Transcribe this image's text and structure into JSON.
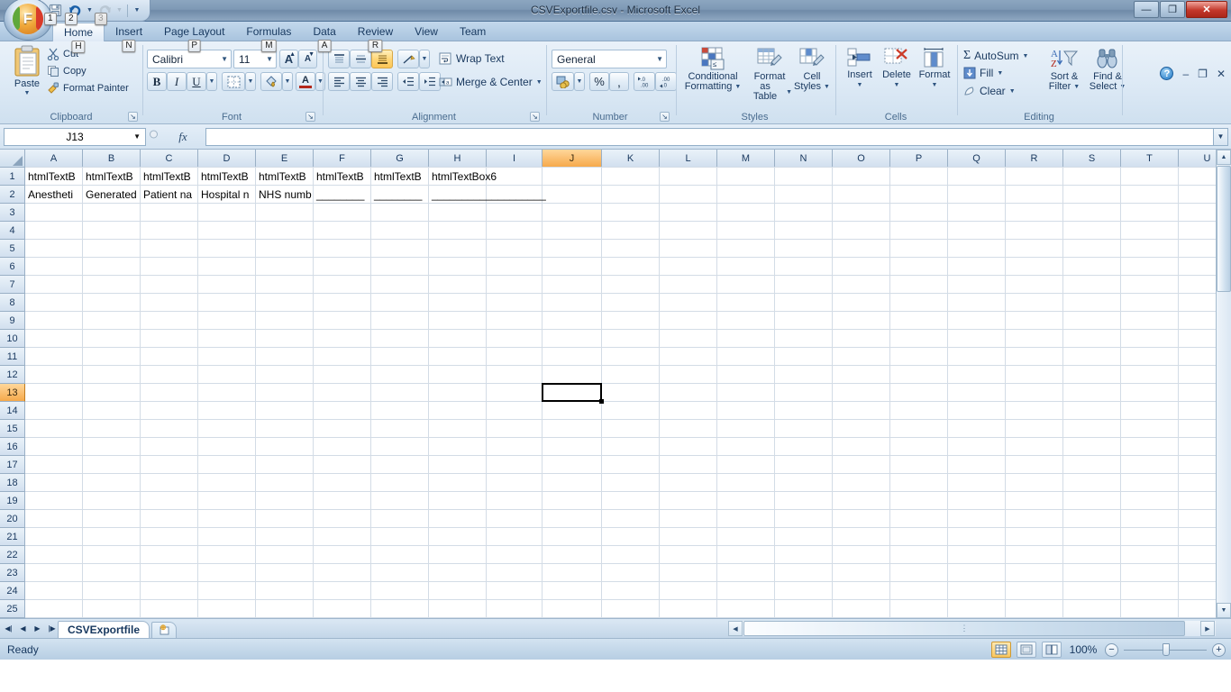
{
  "window": {
    "title": "CSVExportfile.csv - Microsoft Excel",
    "minimize_label": "—",
    "restore_label": "❐",
    "close_label": "✕"
  },
  "ribbon_window_controls": {
    "help_label": "?",
    "minimize_label": "–",
    "restore_label": "❐",
    "close_label": "✕"
  },
  "quick_access": {
    "save_icon": "save-icon",
    "undo_icon": "undo-icon",
    "redo_icon": "redo-icon",
    "customize_icon": "chevron-down-icon",
    "keytips": [
      "1",
      "2",
      "3"
    ]
  },
  "office_button": {
    "label": "F",
    "keytip": "F"
  },
  "tabs": [
    {
      "label": "Home",
      "keytip": "H",
      "active": true
    },
    {
      "label": "Insert",
      "keytip": "N",
      "active": false
    },
    {
      "label": "Page Layout",
      "keytip": "P",
      "active": false
    },
    {
      "label": "Formulas",
      "keytip": "M",
      "active": false
    },
    {
      "label": "Data",
      "keytip": "A",
      "active": false
    },
    {
      "label": "Review",
      "keytip": "R",
      "active": false
    },
    {
      "label": "View",
      "keytip": "",
      "active": false
    },
    {
      "label": "Team",
      "keytip": "",
      "active": false
    }
  ],
  "groups": {
    "clipboard": {
      "label": "Clipboard",
      "paste": "Paste",
      "cut": "Cut",
      "copy": "Copy",
      "format_painter": "Format Painter",
      "launcher": "↘"
    },
    "font": {
      "label": "Font",
      "font_name": "Calibri",
      "font_size": "11",
      "grow_font": "A",
      "shrink_font": "A",
      "bold": "B",
      "italic": "I",
      "underline": "U",
      "borders": "borders-icon",
      "fill_color": "fill-color-icon",
      "font_color": "A",
      "launcher": "↘"
    },
    "alignment": {
      "label": "Alignment",
      "top_align": "top-align-icon",
      "middle_align": "middle-align-icon",
      "bottom_align": "bottom-align-icon",
      "orientation": "orientation-icon",
      "align_left": "align-left-icon",
      "align_center": "align-center-icon",
      "align_right": "align-right-icon",
      "decrease_indent": "decrease-indent-icon",
      "increase_indent": "increase-indent-icon",
      "wrap_text": "Wrap Text",
      "merge_center": "Merge & Center",
      "launcher": "↘"
    },
    "number": {
      "label": "Number",
      "format": "General",
      "accounting": "accounting-format-icon",
      "percent": "%",
      "comma": ",",
      "increase_decimal": "increase-decimal-icon",
      "decrease_decimal": "decrease-decimal-icon",
      "launcher": "↘"
    },
    "styles": {
      "label": "Styles",
      "conditional_formatting": "Conditional\nFormatting",
      "conditional_formatting_line1": "Conditional",
      "conditional_formatting_line2": "Formatting",
      "format_as_table_line1": "Format",
      "format_as_table_line2": "as Table",
      "cell_styles_line1": "Cell",
      "cell_styles_line2": "Styles"
    },
    "cells": {
      "label": "Cells",
      "insert": "Insert",
      "delete": "Delete",
      "format": "Format"
    },
    "editing": {
      "label": "Editing",
      "autosum": "AutoSum",
      "fill": "Fill",
      "clear": "Clear",
      "sort_filter_line1": "Sort &",
      "sort_filter_line2": "Filter",
      "find_select_line1": "Find &",
      "find_select_line2": "Select",
      "sigma": "Σ"
    }
  },
  "formula_bar": {
    "name_box": "J13",
    "fx_label": "fx",
    "formula_value": "",
    "expand_icon": "chevron-down-icon"
  },
  "grid": {
    "columns": [
      "A",
      "B",
      "C",
      "D",
      "E",
      "F",
      "G",
      "H",
      "I",
      "J",
      "K",
      "L",
      "M",
      "N",
      "O",
      "P",
      "Q",
      "R",
      "S",
      "T",
      "U"
    ],
    "selected_column": "J",
    "rows": [
      "1",
      "2",
      "3",
      "4",
      "5",
      "6",
      "7",
      "8",
      "9",
      "10",
      "11",
      "12",
      "13",
      "14",
      "15",
      "16",
      "17",
      "18",
      "19",
      "20",
      "21",
      "22",
      "23",
      "24",
      "25"
    ],
    "selected_row": "13",
    "active_cell": "J13",
    "cells": {
      "A1": "htmlTextB",
      "B1": "htmlTextB",
      "C1": "htmlTextB",
      "D1": "htmlTextB",
      "E1": "htmlTextB",
      "F1": "htmlTextB",
      "G1": "htmlTextB",
      "H1": "htmlTextBox6",
      "A2": "Anestheti",
      "B2": "Generated",
      "C2": "Patient na",
      "D2": "Hospital n",
      "E2": "NHS numb",
      "F2": "________",
      "G2": "________",
      "H2": "___________________"
    }
  },
  "sheet_tabs": {
    "first_icon": "first-sheet-icon",
    "prev_icon": "previous-sheet-icon",
    "next_icon": "next-sheet-icon",
    "last_icon": "last-sheet-icon",
    "tabs": [
      "CSVExportfile"
    ],
    "insert_sheet_icon": "insert-worksheet-icon"
  },
  "status_bar": {
    "status": "Ready",
    "view_normal": "normal-view-icon",
    "view_page_layout": "page-layout-view-icon",
    "view_page_break": "page-break-preview-icon",
    "zoom_percent": "100%",
    "zoom_out": "−",
    "zoom_in": "+"
  },
  "colors": {
    "accent": "#f6a94b",
    "title_bar": "#7e99b5",
    "ribbon": "#dce9f5",
    "text": "#16375e"
  }
}
